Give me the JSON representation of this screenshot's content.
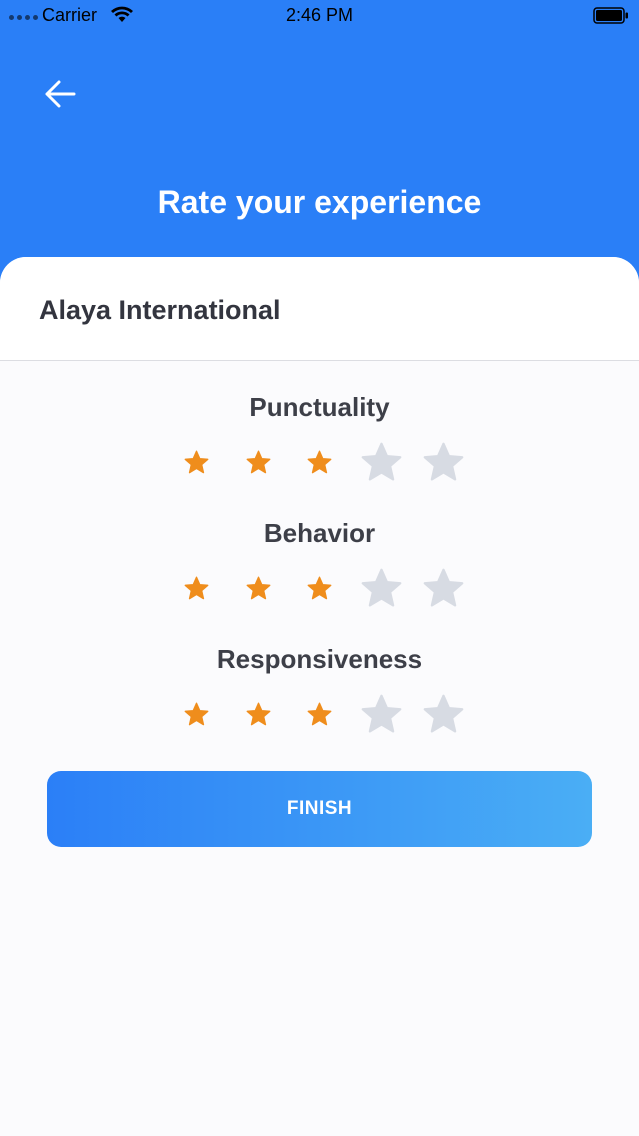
{
  "status_bar": {
    "carrier": "Carrier",
    "time": "2:46 PM"
  },
  "header": {
    "title": "Rate your experience",
    "back_icon": "arrow-left-icon",
    "color": "#2a7ff7"
  },
  "company": {
    "name": "Alaya International"
  },
  "ratings": [
    {
      "label": "Punctuality",
      "value": 3,
      "max": 5
    },
    {
      "label": "Behavior",
      "value": 3,
      "max": 5
    },
    {
      "label": "Responsiveness",
      "value": 3,
      "max": 5
    }
  ],
  "colors": {
    "star_filled": "#ef8d1c",
    "star_empty": "#d7dbe3",
    "button_gradient_start": "#2b7ff7",
    "button_gradient_end": "#4aaef5"
  },
  "finish_label": "FINISH"
}
